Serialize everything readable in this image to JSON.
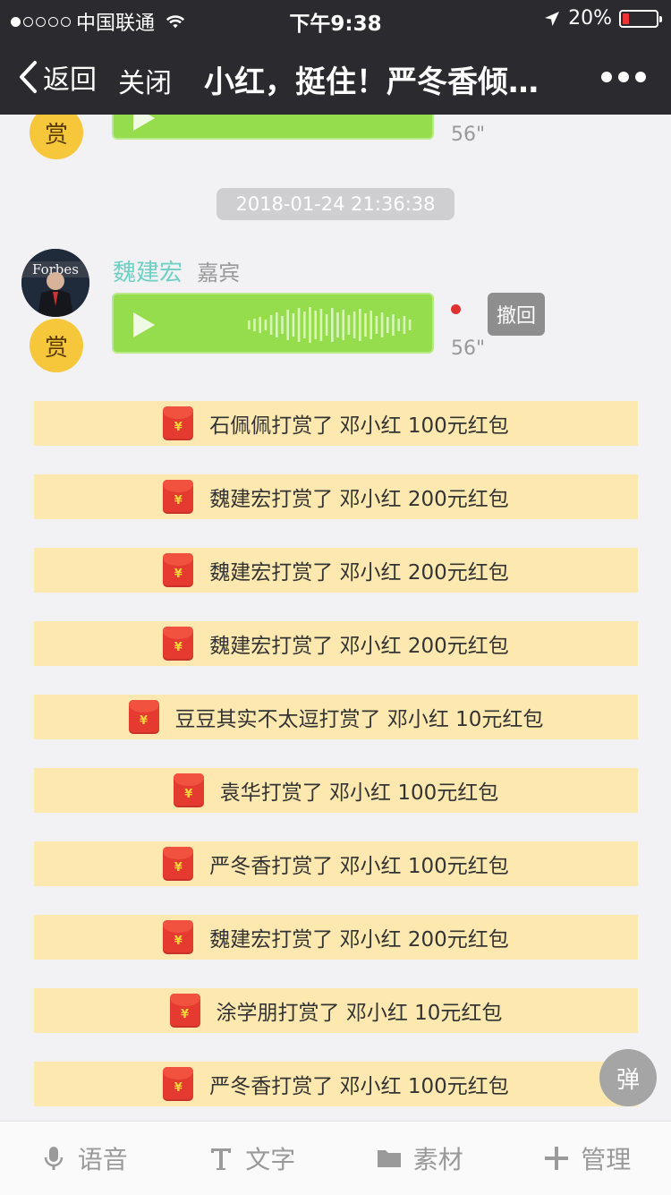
{
  "status_bar": {
    "carrier": "中国联通",
    "time": "下午9:38",
    "battery": "20%",
    "battery_level": 0.2,
    "signal_strength": 1
  },
  "nav": {
    "back_label": "返回",
    "close_label": "关闭",
    "title": "小红，挺住！严冬香倾…"
  },
  "chat": {
    "prev_message": {
      "reward_label": "赏",
      "duration": "56\""
    },
    "timestamp": "2018-01-24 21:36:38",
    "message": {
      "sender_name": "魏建宏",
      "sender_role": "嘉宾",
      "reward_label": "赏",
      "duration": "56\"",
      "recall_label": "撤回",
      "avatar_text": "Forbes"
    },
    "rewards": [
      {
        "text": "石佩佩打赏了 邓小红 100元红包"
      },
      {
        "text": "魏建宏打赏了 邓小红 200元红包"
      },
      {
        "text": "魏建宏打赏了 邓小红 200元红包"
      },
      {
        "text": "魏建宏打赏了 邓小红 200元红包"
      },
      {
        "text": "豆豆其实不太逗打赏了 邓小红 10元红包"
      },
      {
        "text": "袁华打赏了 邓小红 100元红包"
      },
      {
        "text": "严冬香打赏了 邓小红 100元红包"
      },
      {
        "text": "魏建宏打赏了 邓小红 200元红包"
      },
      {
        "text": "涂学朋打赏了 邓小红 10元红包"
      },
      {
        "text": "严冬香打赏了 邓小红 100元红包"
      }
    ],
    "envelope_symbol": "¥",
    "danmu_label": "弹"
  },
  "toolbar": {
    "items": [
      {
        "label": "语音",
        "icon": "microphone-icon"
      },
      {
        "label": "文字",
        "icon": "text-icon"
      },
      {
        "label": "素材",
        "icon": "folder-icon"
      },
      {
        "label": "管理",
        "icon": "plus-icon"
      }
    ]
  },
  "colors": {
    "bar_bg": "#2b2b2f",
    "voice_green": "#96dd4e",
    "reward_bg": "#fde9b0",
    "reward_badge": "#f6c73a",
    "sender_name": "#6ed0c2"
  }
}
